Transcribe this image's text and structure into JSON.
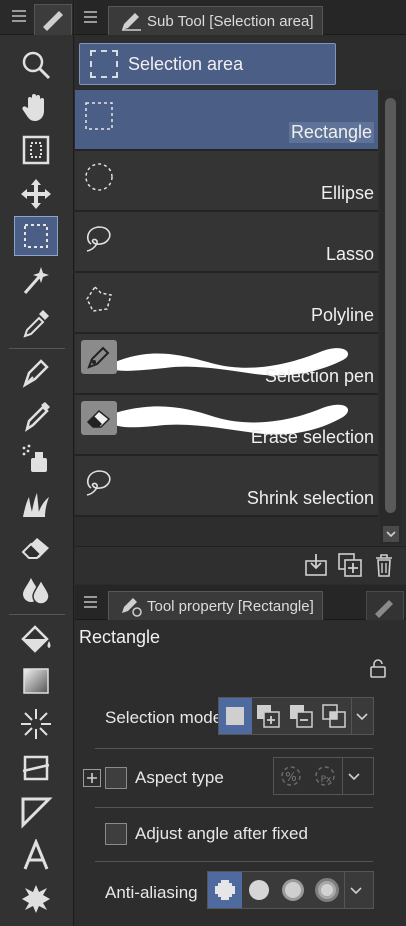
{
  "toolbar": {
    "tools": [
      "zoom-icon",
      "hand-icon",
      "navigator-icon",
      "move-icon",
      "selection-area-icon",
      "magic-wand-icon",
      "eyedropper-icon",
      "pen-icon",
      "pencil-icon",
      "airbrush-icon",
      "decoration-icon",
      "eraser-icon",
      "blend-icon",
      "fill-icon",
      "gradient-icon",
      "figure-icon",
      "frame-border-icon",
      "ruler-icon",
      "text-icon",
      "balloon-icon"
    ],
    "active_tool": "selection-area-icon"
  },
  "subtool": {
    "tab_title": "Sub Tool [Selection area]",
    "group_label": "Selection area",
    "items": [
      {
        "label": "Rectangle"
      },
      {
        "label": "Ellipse"
      },
      {
        "label": "Lasso"
      },
      {
        "label": "Polyline"
      },
      {
        "label": "Selection pen"
      },
      {
        "label": "Erase selection"
      },
      {
        "label": "Shrink selection"
      }
    ],
    "active_item": "Rectangle",
    "footer_icons": [
      "import-icon",
      "duplicate-icon",
      "delete-icon"
    ]
  },
  "toolprop": {
    "tab_title": "Tool property [Rectangle]",
    "title": "Rectangle",
    "rows": {
      "selection_mode": "Selection mode",
      "aspect_type": "Aspect type",
      "adjust_angle": "Adjust angle after fixed",
      "anti_aliasing": "Anti-aliasing"
    }
  },
  "colors": {
    "accent": "#4b5f86",
    "panel_bg": "#2d2d2d",
    "item_bg": "#343434"
  }
}
